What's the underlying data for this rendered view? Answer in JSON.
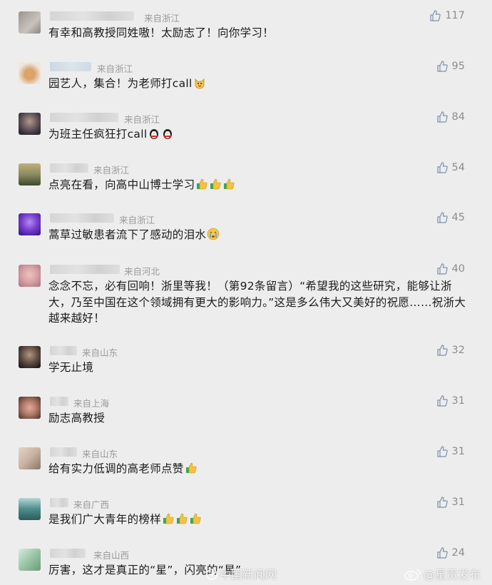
{
  "comments": [
    {
      "location": "来自浙江",
      "text": "有幸和高教授同姓嗷！太励志了！向你学习！",
      "likes": "117",
      "avatar_color": "#b7b0aa"
    },
    {
      "location": "来自浙江",
      "text": "园艺人，集合！为老师打call",
      "likes": "95",
      "avatar_color": "#d9a26c"
    },
    {
      "location": "来自浙江",
      "text": "为班主任疯狂打call",
      "likes": "84",
      "avatar_color": "#4a4550"
    },
    {
      "location": "来自浙江",
      "text": "点亮在看，向高中山博士学习",
      "likes": "54",
      "avatar_color": "#8c8a62"
    },
    {
      "location": "来自浙江",
      "text": "蒿草过敏患者流下了感动的泪水",
      "likes": "45",
      "avatar_color": "#7b3fd0"
    },
    {
      "location": "来自河北",
      "text": "念念不忘，必有回响！浙里等我！（第92条留言）“希望我的这些研究，能够让浙大，乃至中国在这个领域拥有更大的影响力。”这是多么伟大又美好的祝愿……祝浙大越来越好！",
      "likes": "40",
      "avatar_color": "#d8a3a7"
    },
    {
      "location": "来自山东",
      "text": "学无止境",
      "likes": "32",
      "avatar_color": "#5b4a40"
    },
    {
      "location": "来自上海",
      "text": "励志高教授",
      "likes": "31",
      "avatar_color": "#b07b69"
    },
    {
      "location": "来自山东",
      "text": "给有实力低调的高老师点赞",
      "likes": "31",
      "avatar_color": "#c8b3a2"
    },
    {
      "location": "来自广西",
      "text": "是我们广大青年的榜样",
      "likes": "31",
      "avatar_color": "#4c8e8a"
    },
    {
      "location": "来自山西",
      "text": "厉害，这才是真正的“星”，闪亮的“星”",
      "likes": "24",
      "avatar_color": "#9ac4a6"
    }
  ],
  "watermark": {
    "left_text": "中国新闻网",
    "right_text": "@星贡发布"
  },
  "colors": {
    "background": "#ededed",
    "text": "#1a1a1a",
    "secondary": "#9a9a9a",
    "like": "#8c8c8c"
  }
}
